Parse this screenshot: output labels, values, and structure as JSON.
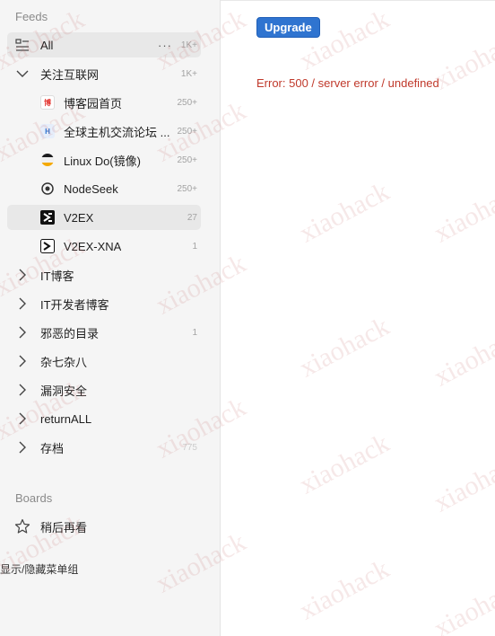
{
  "sidebar": {
    "feeds_title": "Feeds",
    "all": {
      "label": "All",
      "more": "···",
      "count": "1K+"
    },
    "folder_open": {
      "label": "关注互联网",
      "count": "1K+"
    },
    "feeds": [
      {
        "label": "博客园首页",
        "count": "250+"
      },
      {
        "label": "全球主机交流论坛 ...",
        "count": "250+"
      },
      {
        "label": "Linux Do(镜像)",
        "count": "250+"
      },
      {
        "label": "NodeSeek",
        "count": "250+"
      },
      {
        "label": "V2EX",
        "count": "27"
      },
      {
        "label": "V2EX-XNA",
        "count": "1"
      }
    ],
    "folders": [
      {
        "label": "IT博客",
        "count": ""
      },
      {
        "label": "IT开发者博客",
        "count": ""
      },
      {
        "label": "邪恶的目录",
        "count": "1"
      },
      {
        "label": "杂七杂八",
        "count": ""
      },
      {
        "label": "漏洞安全",
        "count": ""
      },
      {
        "label": "returnALL",
        "count": ""
      },
      {
        "label": "存档",
        "count": "775"
      }
    ],
    "boards_title": "Boards",
    "board_item": {
      "label": "稍后再看"
    },
    "toggle_groups": "显示/隐藏菜单组"
  },
  "main": {
    "upgrade_label": "Upgrade",
    "error_message": "Error: 500 / server error / undefined"
  },
  "watermark": {
    "text": "xiaohack"
  },
  "colors": {
    "accent": "#2f74d0",
    "error": "#c0392b",
    "sidebar_bg": "#f5f5f5"
  }
}
